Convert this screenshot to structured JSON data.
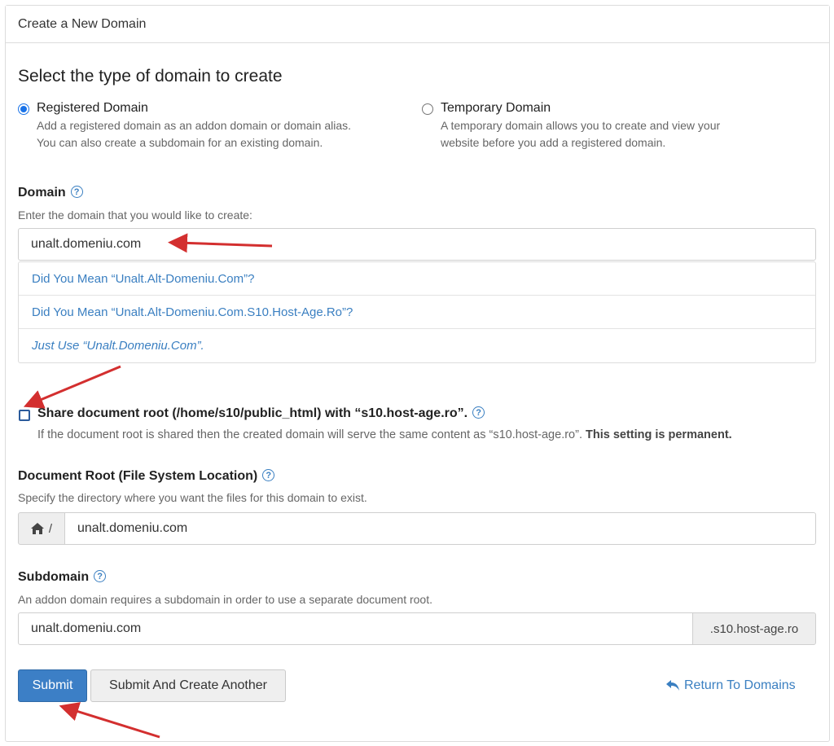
{
  "panel": {
    "title": "Create a New Domain"
  },
  "type_section": {
    "heading": "Select the type of domain to create",
    "options": [
      {
        "title": "Registered Domain",
        "desc_line1": "Add a registered domain as an addon domain or domain alias.",
        "desc_line2": "You can also create a subdomain for an existing domain.",
        "selected": true
      },
      {
        "title": "Temporary Domain",
        "desc_line1": "A temporary domain allows you to create and view your",
        "desc_line2": "website before you add a registered domain.",
        "selected": false
      }
    ]
  },
  "domain": {
    "label": "Domain",
    "hint": "Enter the domain that you would like to create:",
    "value": "unalt.domeniu.com",
    "suggestions": [
      "Did You Mean “Unalt.Alt-Domeniu.Com”?",
      "Did You Mean “Unalt.Alt-Domeniu.Com.S10.Host-Age.Ro”?",
      "Just Use “Unalt.Domeniu.Com”."
    ]
  },
  "share_root": {
    "label": "Share document root (/home/s10/public_html) with “s10.host-age.ro”.",
    "desc": "If the document root is shared then the created domain will serve the same content as “s10.host-age.ro”.",
    "desc_bold": "This setting is permanent.",
    "checked": false
  },
  "doc_root": {
    "label": "Document Root (File System Location)",
    "hint": "Specify the directory where you want the files for this domain to exist.",
    "prefix": "/",
    "value": "unalt.domeniu.com"
  },
  "subdomain": {
    "label": "Subdomain",
    "hint": "An addon domain requires a subdomain in order to use a separate document root.",
    "value": "unalt.domeniu.com",
    "suffix": ".s10.host-age.ro"
  },
  "actions": {
    "submit": "Submit",
    "submit_another": "Submit And Create Another",
    "return": "Return To Domains"
  },
  "colors": {
    "accent": "#3c7fc6",
    "link": "#3a7fc1",
    "annotation_arrow": "#d32f2f"
  },
  "icons": {
    "help": "question-circle-icon",
    "home": "home-icon",
    "return": "reply-arrow-icon"
  }
}
